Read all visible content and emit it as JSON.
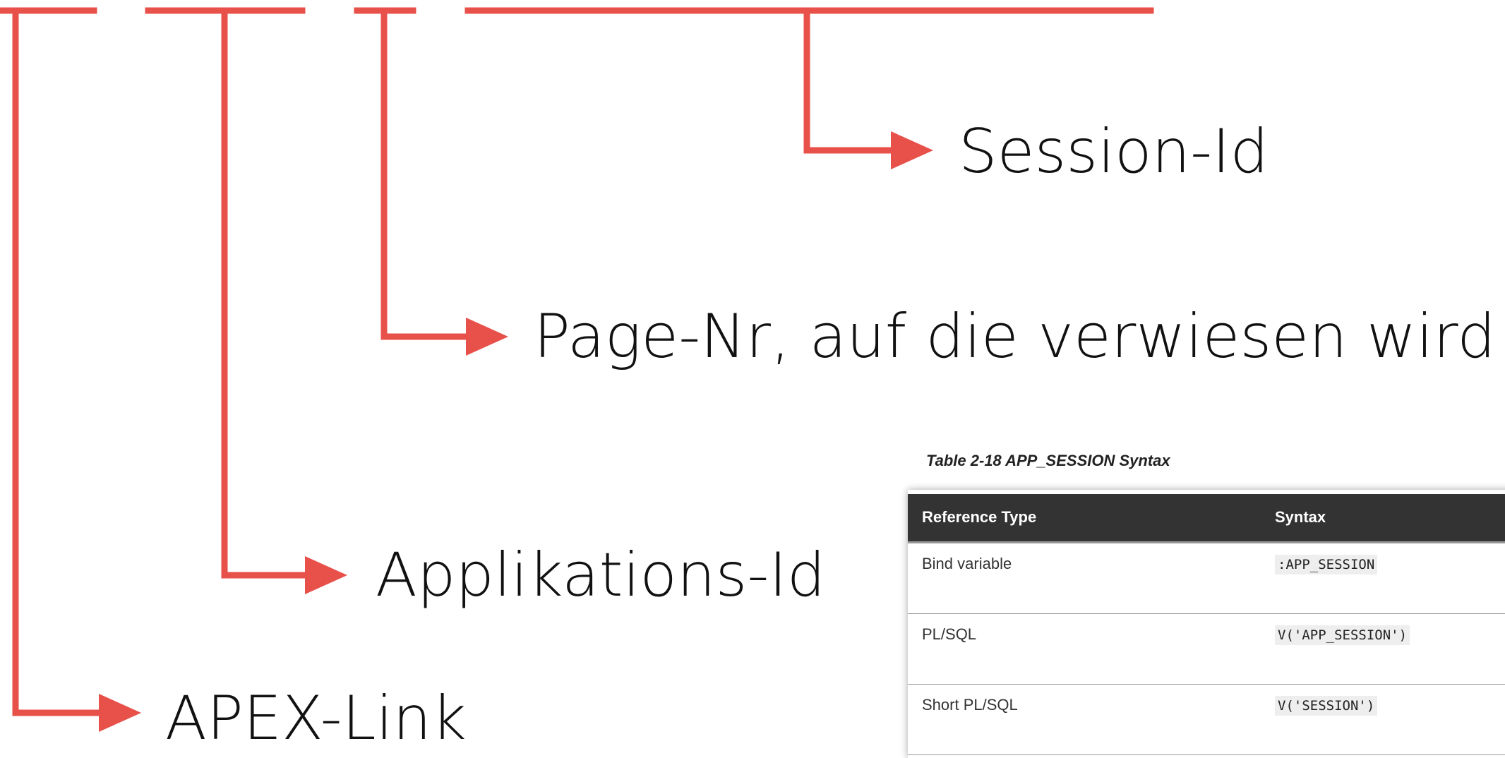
{
  "labels": {
    "session_id": "Session-Id",
    "page_nr": "Page-Nr, auf die verwiesen wird",
    "application_id": "Applikations-Id",
    "apex_link": "APEX-Link"
  },
  "colors": {
    "arrow": "#e8504a",
    "text": "#111111",
    "table_header_bg": "#333333"
  },
  "table": {
    "caption": "Table 2-18 APP_SESSION Syntax",
    "headers": [
      "Reference Type",
      "Syntax"
    ],
    "rows": [
      {
        "type": "Bind variable",
        "syntax": ":APP_SESSION"
      },
      {
        "type": "PL/SQL",
        "syntax": "V('APP_SESSION')"
      },
      {
        "type": "Short PL/SQL",
        "syntax": "V('SESSION')"
      }
    ]
  }
}
